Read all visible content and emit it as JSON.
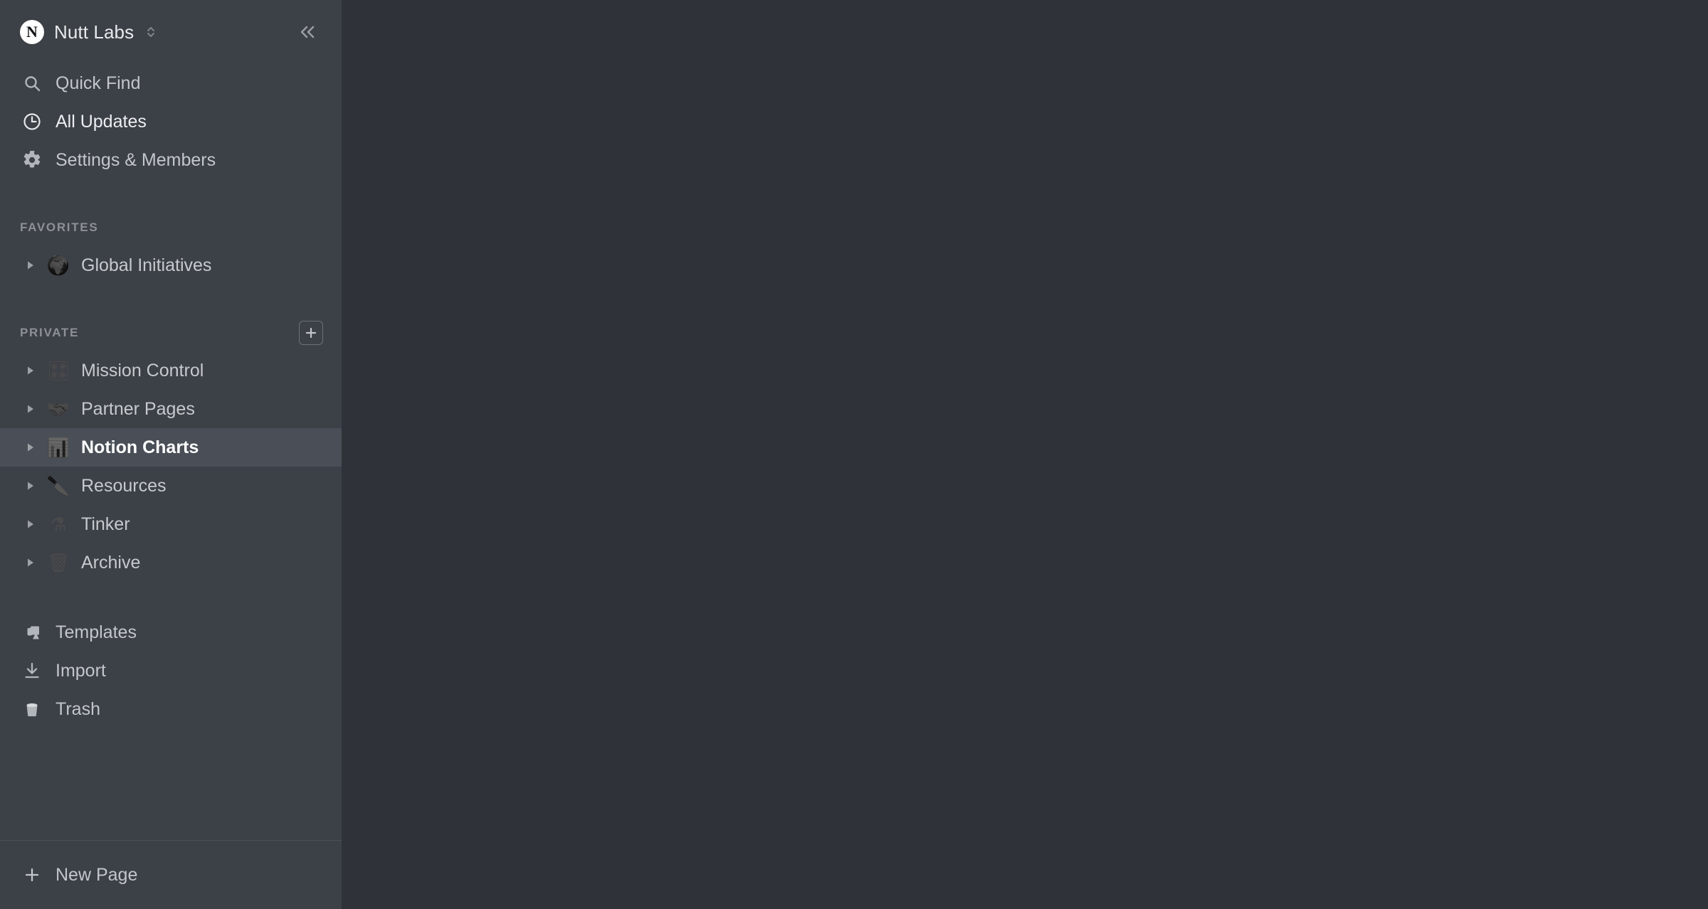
{
  "workspace": {
    "name": "Nutt Labs",
    "avatar_letter": "N",
    "switcher_icon": "chevron-up-down-icon",
    "collapse_icon": "double-chevron-left-icon"
  },
  "top_nav": [
    {
      "label": "Quick Find",
      "icon": "search-icon"
    },
    {
      "label": "All Updates",
      "icon": "clock-icon"
    },
    {
      "label": "Settings & Members",
      "icon": "gear-icon"
    }
  ],
  "favorites": {
    "label": "FAVORITES",
    "items": [
      {
        "label": "Global Initiatives",
        "emoji": "🌍",
        "emoji_name": "globe-icon"
      }
    ]
  },
  "private": {
    "label": "PRIVATE",
    "add_icon": "plus-icon",
    "items": [
      {
        "label": "Mission Control",
        "emoji": "🎛",
        "emoji_name": "control-knobs-icon",
        "selected": false
      },
      {
        "label": "Partner Pages",
        "emoji": "🤝",
        "emoji_name": "handshake-icon",
        "selected": false
      },
      {
        "label": "Notion Charts",
        "emoji": "📊",
        "emoji_name": "pie-chart-icon",
        "selected": true
      },
      {
        "label": "Resources",
        "emoji": "🔪",
        "emoji_name": "swiss-army-knife-icon",
        "selected": false
      },
      {
        "label": "Tinker",
        "emoji": "⚗",
        "emoji_name": "alembic-icon",
        "selected": false
      },
      {
        "label": "Archive",
        "emoji": "🗑",
        "emoji_name": "wastebasket-icon",
        "selected": false
      }
    ]
  },
  "utility_nav": [
    {
      "label": "Templates",
      "icon": "shapes-icon"
    },
    {
      "label": "Import",
      "icon": "download-icon"
    },
    {
      "label": "Trash",
      "icon": "trash-icon"
    }
  ],
  "footer": {
    "new_page_label": "New Page",
    "new_page_icon": "plus-icon"
  },
  "colors": {
    "sidebar_bg": "#3c4047",
    "main_bg": "#2f3238",
    "selected_row_bg": "#4a4f57",
    "text_primary": "#e9eaec",
    "text_muted": "#8d9196"
  }
}
